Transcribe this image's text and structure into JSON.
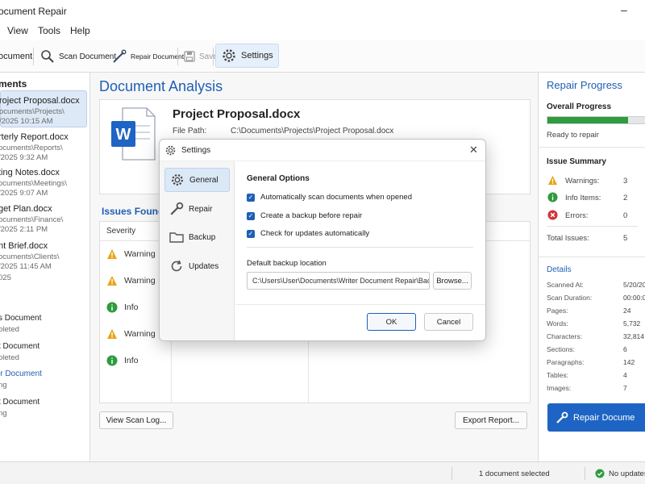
{
  "window": {
    "title": "ocument Repair",
    "minimize": "–"
  },
  "menu": [
    "View",
    "Tools",
    "Help"
  ],
  "toolbar": {
    "open": "ocument",
    "scan": "Scan Document",
    "repair": "Repair Document",
    "save": "Save",
    "settings": "Settings"
  },
  "left": {
    "header": "ments",
    "documents": [
      {
        "name": "roject Proposal.docx",
        "path": "ocuments\\Projects\\",
        "time": "/2025   10:15 AM"
      },
      {
        "name": "rterly Report.docx",
        "path": "ocuments\\Reports\\",
        "time": "/2025   9:32 AM"
      },
      {
        "name": "ting Notes.docx",
        "path": "ocuments\\Meetings\\",
        "time": "/2025   9:07 AM"
      },
      {
        "name": "get Plan.docx",
        "path": "ocuments\\Finance\\",
        "time": "/2025   2:11 PM"
      },
      {
        "name": "nt Brief.docx",
        "path": "ocuments\\Clients\\",
        "time": "/2025   11:45 AM"
      }
    ],
    "partial_date": "025",
    "recent": [
      {
        "name": "s Document",
        "status": "oleted"
      },
      {
        "name": "t Document",
        "status": "oleted"
      },
      {
        "name": "ir Document",
        "status": "ng"
      },
      {
        "name": "t Document",
        "status": "ng"
      }
    ]
  },
  "main": {
    "heading": "Document Analysis",
    "file_name": "Project Proposal.docx",
    "file_path_label": "File Path:",
    "file_path": "C:\\Documents\\Projects\\Project Proposal.docx",
    "issues_title": "Issues Found",
    "severity_header": "Severity",
    "issues": [
      {
        "severity": "Warning",
        "icon": "warning-icon"
      },
      {
        "severity": "Warning",
        "icon": "warning-icon"
      },
      {
        "severity": "Info",
        "icon": "info-icon"
      },
      {
        "severity": "Warning",
        "icon": "warning-icon"
      },
      {
        "severity": "Info",
        "icon": "info-icon"
      }
    ],
    "view_log": "View Scan Log...",
    "export": "Export Report..."
  },
  "progress": {
    "title": "Repair Progress",
    "overall_label": "Overall Progress",
    "overall_fraction": 0.78,
    "status": "Ready to repair",
    "summary_title": "Issue Summary",
    "warnings_label": "Warnings:",
    "warnings": "3",
    "info_label": "Info Items:",
    "info": "2",
    "errors_label": "Errors:",
    "errors": "0",
    "total_label": "Total Issues:",
    "total": "5",
    "details_title": "Details",
    "details": [
      {
        "label": "Scanned At:",
        "value": "5/20/20"
      },
      {
        "label": "Scan Duration:",
        "value": "00:00:0"
      },
      {
        "label": "Pages:",
        "value": "24"
      },
      {
        "label": "Words:",
        "value": "5,732"
      },
      {
        "label": "Characters:",
        "value": "32,814"
      },
      {
        "label": "Sections:",
        "value": "6"
      },
      {
        "label": "Paragraphs:",
        "value": "142"
      },
      {
        "label": "Tables:",
        "value": "4"
      },
      {
        "label": "Images:",
        "value": "7"
      }
    ],
    "repair_button": "Repair Docume"
  },
  "status": {
    "selected": "1 document selected",
    "updates": "No updates a"
  },
  "dialog": {
    "title": "Settings",
    "close": "✕",
    "nav": [
      "General",
      "Repair",
      "Backup",
      "Updates"
    ],
    "section_title": "General Options",
    "options": [
      "Automatically scan documents when opened",
      "Create a backup before repair",
      "Check for updates automatically"
    ],
    "backup_label": "Default backup location",
    "backup_path": "C:\\Users\\User\\Documents\\Writer Document Repair\\Backups",
    "browse": "Browse...",
    "ok": "OK",
    "cancel": "Cancel"
  },
  "colors": {
    "accent": "#1f5fb4",
    "progress": "#2e9b3e",
    "warning": "#e8a317",
    "info": "#2e9b3e",
    "error": "#d13438"
  }
}
